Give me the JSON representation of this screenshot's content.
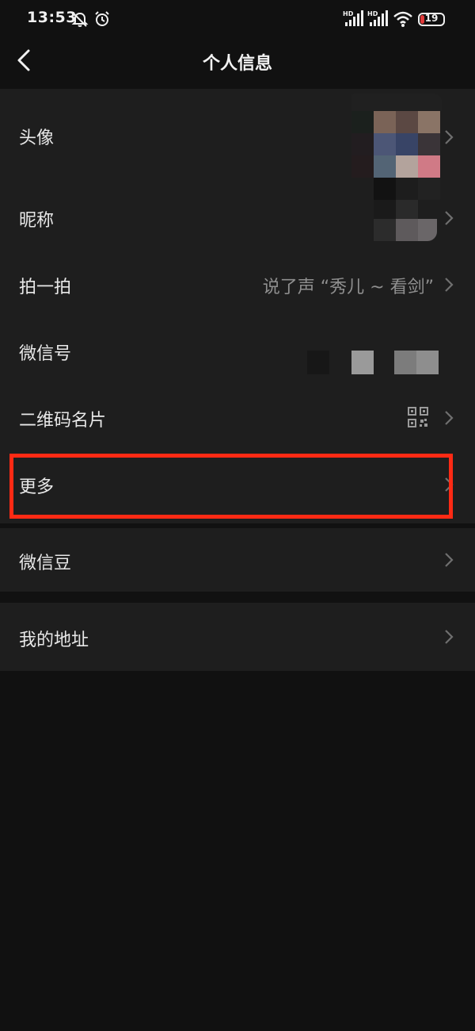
{
  "status_bar": {
    "time": "13:53",
    "icons": [
      "mute-bell-icon",
      "alarm-icon",
      "signal-hd-icon",
      "signal-hd-icon",
      "wifi-icon",
      "battery-icon"
    ],
    "battery_level": "19",
    "battery_color": "#e23b3b"
  },
  "nav": {
    "title": "个人信息",
    "back_icon": "chevron-left-icon"
  },
  "profile": {
    "items": [
      {
        "label": "头像",
        "value": ""
      },
      {
        "label": "昵称",
        "value": ""
      },
      {
        "label": "拍一拍",
        "value": "说了声 “秀儿 ~ 看剑”"
      },
      {
        "label": "微信号",
        "value": ""
      },
      {
        "label": "二维码名片",
        "value": "",
        "icon": "qr-code-icon"
      },
      {
        "label": "更多",
        "value": ""
      }
    ]
  },
  "wallet": {
    "items": [
      {
        "label": "微信豆"
      }
    ]
  },
  "address": {
    "items": [
      {
        "label": "我的地址"
      }
    ]
  },
  "colors": {
    "background": "#111111",
    "card": "#1e1e1e",
    "highlight": "#ff2a14"
  }
}
